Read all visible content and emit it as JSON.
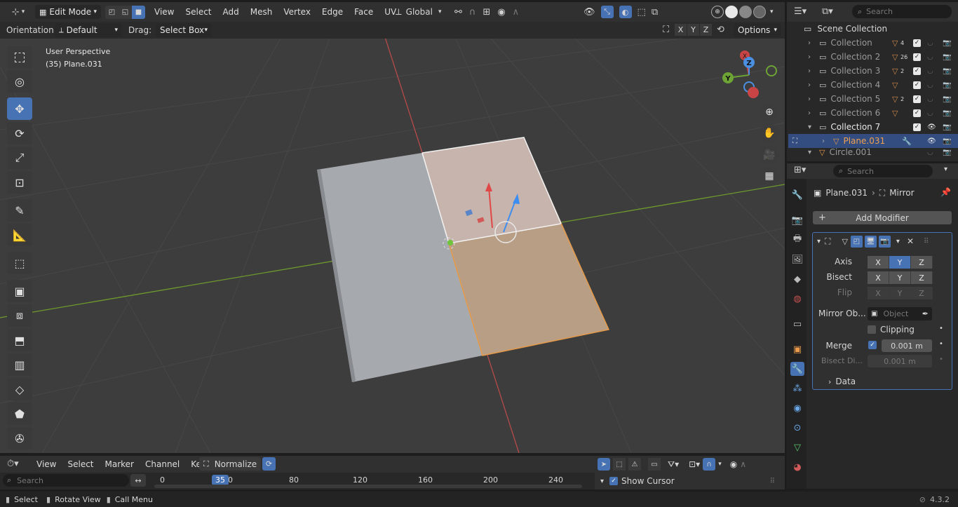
{
  "viewport_header": {
    "mode": "Edit Mode",
    "menu": [
      "View",
      "Select",
      "Add",
      "Mesh",
      "Vertex",
      "Edge",
      "Face",
      "UV"
    ],
    "transform_orientation": "Global"
  },
  "tool_settings": {
    "orientation_label": "Orientation:",
    "orientation_value": "Default",
    "drag_label": "Drag:",
    "drag_value": "Select Box",
    "axes": [
      "X",
      "Y",
      "Z"
    ],
    "options_label": "Options"
  },
  "viewport": {
    "perspective": "User Perspective",
    "object_info": "(35) Plane.031",
    "gizmo": {
      "x": "X",
      "y": "Y",
      "z": "Z"
    }
  },
  "outliner": {
    "search_placeholder": "Search",
    "scene_collection": "Scene Collection",
    "rows": [
      {
        "label": "Collection",
        "badge": "4"
      },
      {
        "label": "Collection 2",
        "badge": "26"
      },
      {
        "label": "Collection 3",
        "badge": "2"
      },
      {
        "label": "Collection 4",
        "badge": ""
      },
      {
        "label": "Collection 5",
        "badge": "2"
      },
      {
        "label": "Collection 6",
        "badge": ""
      },
      {
        "label": "Collection 7",
        "badge": ""
      },
      {
        "label": "Plane.031",
        "badge": ""
      },
      {
        "label": "Circle.001",
        "badge": ""
      }
    ]
  },
  "properties": {
    "search_placeholder": "Search",
    "breadcrumb_object": "Plane.031",
    "breadcrumb_modifier": "Mirror",
    "add_modifier": "Add Modifier",
    "axis_label": "Axis",
    "bisect_label": "Bisect",
    "flip_label": "Flip",
    "xyz": [
      "X",
      "Y",
      "Z"
    ],
    "mirror_object_label": "Mirror Ob...",
    "mirror_object_placeholder": "Object",
    "clipping_label": "Clipping",
    "merge_label": "Merge",
    "merge_value": "0.001 m",
    "bisect_distance_label": "Bisect Di...",
    "bisect_distance_value": "0.001 m",
    "data_label": "Data"
  },
  "timeline": {
    "menu": [
      "View",
      "Select",
      "Marker",
      "Channel",
      "Key"
    ],
    "normalize_label": "Normalize",
    "search_placeholder": "Search",
    "current_frame": "35",
    "ticks": [
      "0",
      "40",
      "80",
      "120",
      "160",
      "200",
      "240"
    ],
    "show_cursor_label": "Show Cursor"
  },
  "status_bar": {
    "select": "Select",
    "rotate_view": "Rotate View",
    "call_menu": "Call Menu",
    "version": "4.3.2"
  }
}
